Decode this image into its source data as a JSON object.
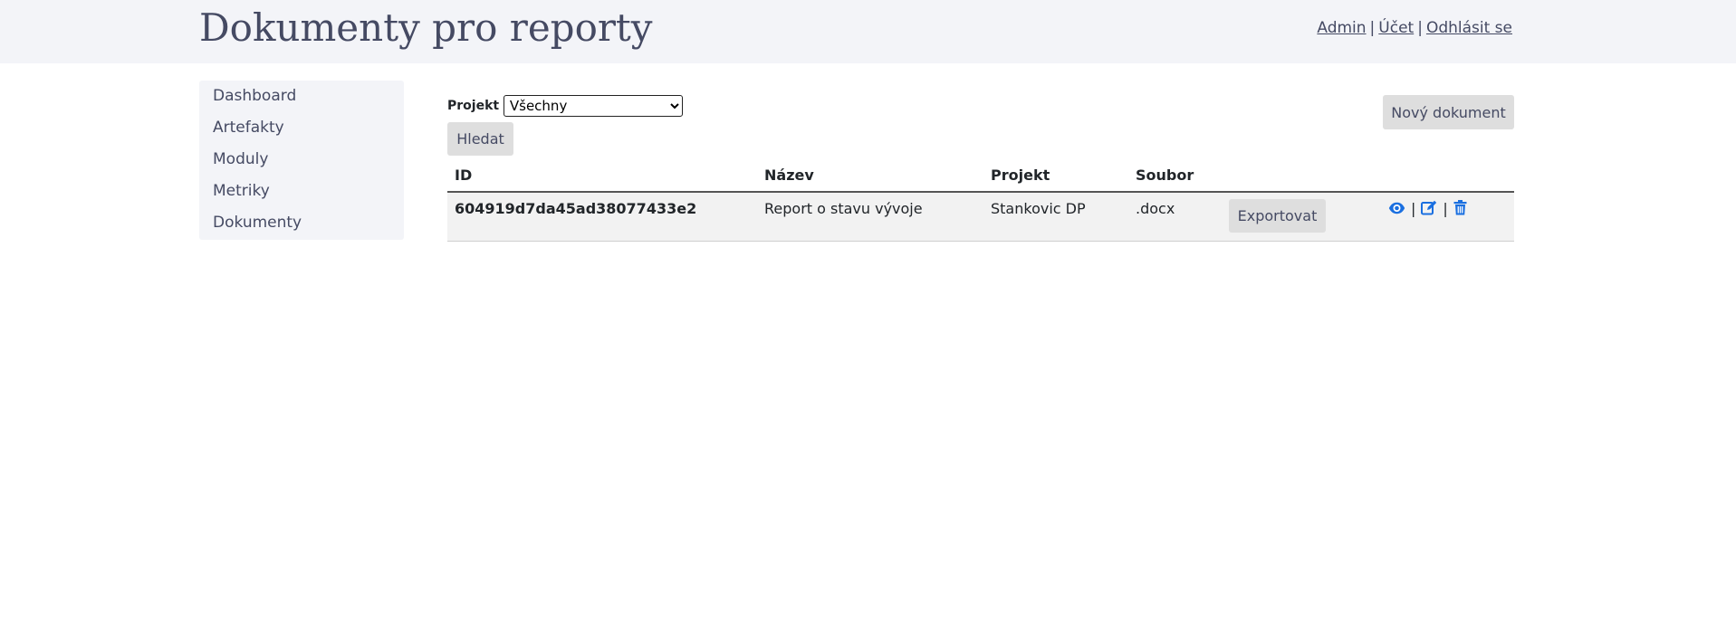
{
  "header": {
    "title": "Dokumenty pro reporty",
    "links": [
      {
        "label": "Admin"
      },
      {
        "label": "Účet"
      },
      {
        "label": "Odhlásit se"
      }
    ],
    "separator": "|"
  },
  "sidebar": {
    "items": [
      {
        "label": "Dashboard"
      },
      {
        "label": "Artefakty"
      },
      {
        "label": "Moduly"
      },
      {
        "label": "Metriky"
      },
      {
        "label": "Dokumenty"
      }
    ]
  },
  "filter": {
    "label": "Projekt",
    "selected": "Všechny",
    "search_label": "Hledat"
  },
  "toolbar": {
    "new_document_label": "Nový dokument"
  },
  "table": {
    "columns": [
      "ID",
      "Název",
      "Projekt",
      "Soubor",
      "",
      ""
    ],
    "rows": [
      {
        "id": "604919d7da45ad38077433e2",
        "name": "Report o stavu vývoje",
        "project": "Stankovic DP",
        "file": ".docx",
        "export_label": "Exportovat",
        "actions": [
          "eye-icon",
          "edit-icon",
          "trash-icon"
        ],
        "separator": "|"
      }
    ]
  },
  "colors": {
    "header_bg": "#f3f4f8",
    "title": "#454a63",
    "button_bg": "#dedede",
    "icon_blue": "#1a6fe0",
    "row_bg": "#f2f2f2"
  }
}
